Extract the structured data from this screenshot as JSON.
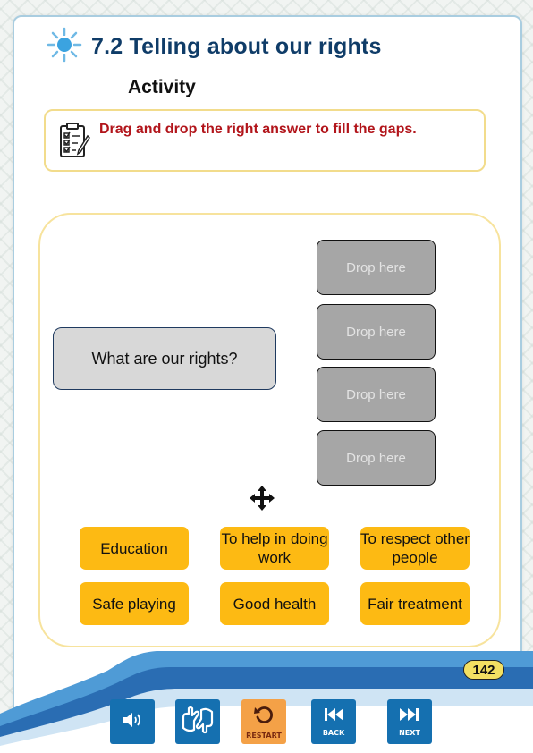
{
  "header": {
    "title": "7.2 Telling about our rights",
    "subtitle": "Activity"
  },
  "instruction": {
    "text": "Drag and drop the right answer to fill the gaps."
  },
  "activity": {
    "question": "What are our rights?",
    "drop_zones": [
      "Drop here",
      "Drop here",
      "Drop here",
      "Drop here"
    ],
    "options": [
      "Education",
      "To help in doing work",
      "To respect other people",
      "Safe playing",
      "Good health",
      "Fair treatment"
    ]
  },
  "footer": {
    "page_number": "142",
    "buttons": {
      "restart": "RESTART",
      "back": "BACK",
      "next": "NEXT"
    }
  },
  "colors": {
    "option": "#fdba13",
    "drop_zone": "#a6a6a6",
    "nav_button": "#1570b0",
    "restart_button": "#f4a147",
    "title": "#0f3c68",
    "instruction": "#b2151b"
  }
}
